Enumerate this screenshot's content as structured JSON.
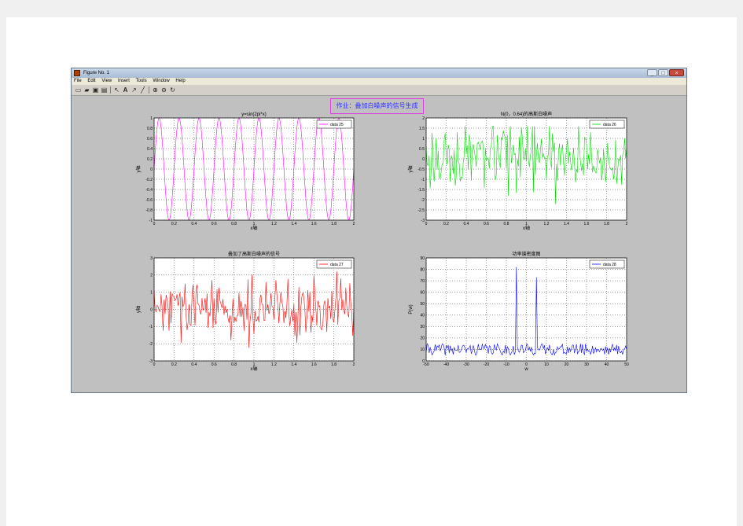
{
  "window": {
    "title": "Figure No. 1",
    "menu": [
      "File",
      "Edit",
      "View",
      "Insert",
      "Tools",
      "Window",
      "Help"
    ],
    "controls": {
      "minimize": "_",
      "maximize": "□",
      "close": "×"
    },
    "toolbar_icons": [
      "new-file-icon",
      "open-folder-icon",
      "save-icon",
      "print-icon",
      "select-arrow-icon",
      "text-tool-icon",
      "arrow-tool-icon",
      "line-tool-icon",
      "zoom-in-icon",
      "zoom-out-icon",
      "rotate-icon"
    ]
  },
  "figure": {
    "suptitle": "作业：叠加白噪声的信号生成"
  },
  "chart_data": [
    {
      "type": "line",
      "title": "y=sin(2pi*x)",
      "xlabel": "x轴",
      "ylabel": "y轴",
      "xlim": [
        0,
        2
      ],
      "ylim": [
        -1,
        1
      ],
      "xticks": [
        "0",
        "0.2",
        "0.4",
        "0.6",
        "0.8",
        "1",
        "1.2",
        "1.4",
        "1.6",
        "1.8",
        "2"
      ],
      "yticks": [
        "-1",
        "-0.8",
        "-0.6",
        "-0.4",
        "-0.2",
        "0",
        "0.2",
        "0.4",
        "0.6",
        "0.8",
        "1"
      ],
      "grid": true,
      "legend_position": "top-right",
      "series": [
        {
          "name": "data 25",
          "color": "#ff00ff",
          "function": "sin(2*pi*5*x)",
          "cycles": 10
        }
      ]
    },
    {
      "type": "line",
      "title": "N(0，0.64)的高斯白噪声",
      "xlabel": "x轴",
      "ylabel": "y轴",
      "xlim": [
        0,
        2
      ],
      "ylim": [
        -3,
        2
      ],
      "xticks": [
        "0",
        "0.2",
        "0.4",
        "0.6",
        "0.8",
        "1",
        "1.2",
        "1.4",
        "1.6",
        "1.8",
        "2"
      ],
      "yticks": [
        "-3",
        "-2.5",
        "-2",
        "-1.5",
        "-1",
        "-0.5",
        "0",
        "0.5",
        "1",
        "1.5",
        "2"
      ],
      "grid": true,
      "legend_position": "top-right",
      "series": [
        {
          "name": "data 26",
          "color": "#00dd00",
          "noise_std": 0.8,
          "seed": 17,
          "min": -2.6,
          "max": 1.6,
          "points": 200
        }
      ]
    },
    {
      "type": "line",
      "title": "叠加了高斯白噪声的信号",
      "xlabel": "x轴",
      "ylabel": "y轴",
      "xlim": [
        0,
        2
      ],
      "ylim": [
        -3,
        3
      ],
      "xticks": [
        "0",
        "0.2",
        "0.4",
        "0.6",
        "0.8",
        "1",
        "1.2",
        "1.4",
        "1.6",
        "1.8",
        "2"
      ],
      "yticks": [
        "-3",
        "-2",
        "-1",
        "0",
        "1",
        "2",
        "3"
      ],
      "grid": true,
      "legend_position": "top-right",
      "series": [
        {
          "name": "data 27",
          "color": "#ff0000",
          "noise_std": 0.8,
          "seed": 29,
          "min": -2.7,
          "max": 2.4,
          "points": 200
        }
      ]
    },
    {
      "type": "line",
      "title": "功率谱密度图",
      "xlabel": "w",
      "ylabel": "P(w)",
      "xlim": [
        -50,
        50
      ],
      "ylim": [
        0,
        90
      ],
      "xticks": [
        "-50",
        "-40",
        "-30",
        "-20",
        "-10",
        "0",
        "10",
        "20",
        "30",
        "40",
        "50"
      ],
      "yticks": [
        "0",
        "10",
        "20",
        "30",
        "40",
        "50",
        "60",
        "70",
        "80",
        "90"
      ],
      "grid": true,
      "legend_position": "top-right",
      "series": [
        {
          "name": "data 28",
          "color": "#0000ff",
          "baseline": 10,
          "noise_amp": 5,
          "seed": 41,
          "peaks": [
            {
              "w": -5,
              "value": 82
            },
            {
              "w": 5,
              "value": 73
            }
          ],
          "points": 200
        }
      ]
    }
  ]
}
